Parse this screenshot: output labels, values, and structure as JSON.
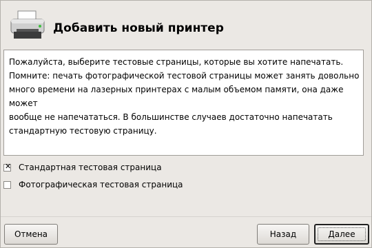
{
  "window": {
    "title": "Добавить новый принтер"
  },
  "icons": {
    "header": "printer-icon"
  },
  "main": {
    "description": "Пожалуйста, выберите тестовые страницы, которые вы хотите напечатать.\nПомните: печать фотографической тестовой страницы может занять довольно\nмного времени на лазерных принтерах с малым объемом памяти, она даже может\nвообще не напечататься. В большинстве случаев достаточно напечатать\nстандартную тестовую страницу."
  },
  "options": [
    {
      "label": "Стандартная тестовая страница",
      "checked": true,
      "mark": "✕"
    },
    {
      "label": "Фотографическая тестовая страница",
      "checked": false,
      "mark": ""
    }
  ],
  "buttons": {
    "cancel": "Отмена",
    "back": "Назад",
    "next": "Далее"
  }
}
